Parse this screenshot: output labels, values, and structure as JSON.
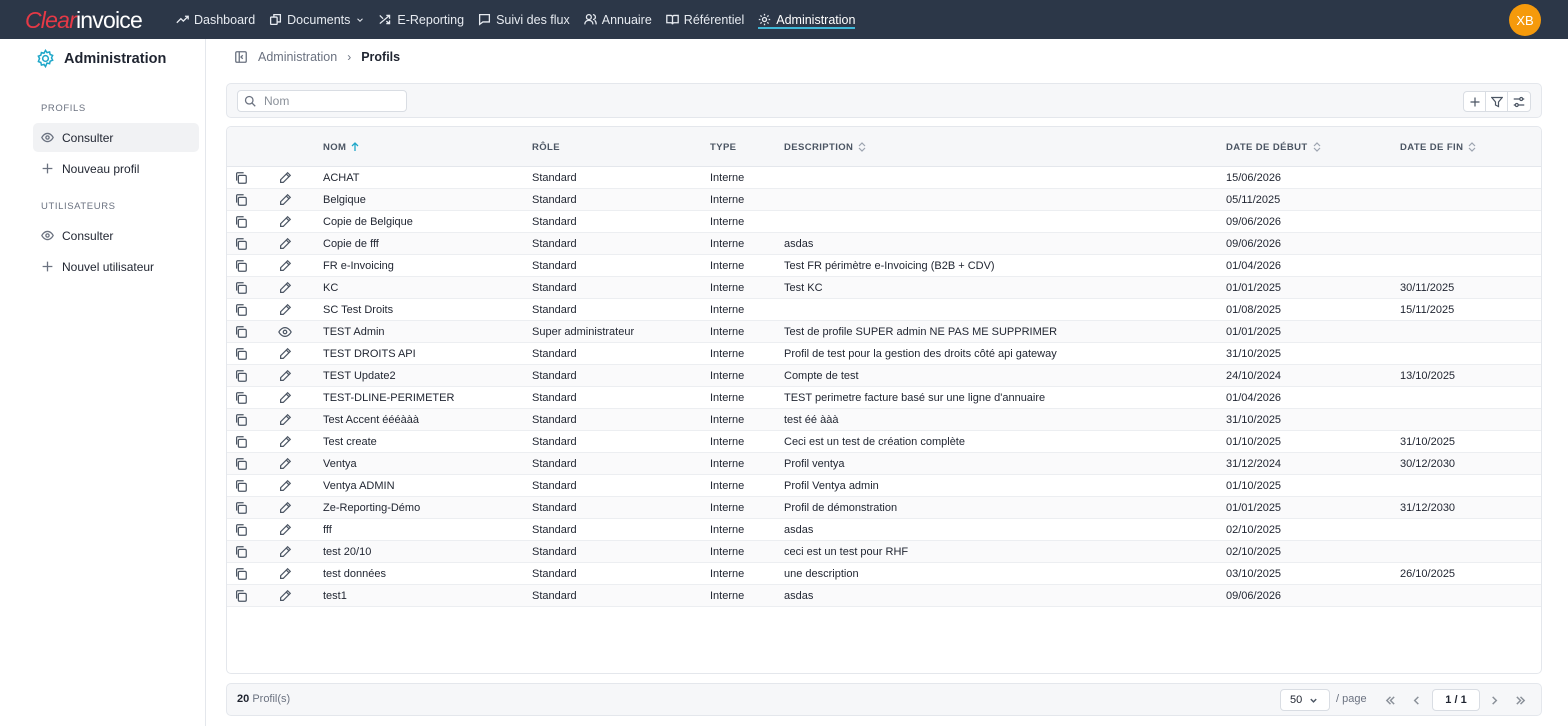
{
  "brand": {
    "part1": "Clear",
    "part2": "invoice"
  },
  "nav": [
    {
      "label": "Dashboard",
      "icon": "trending-up-icon"
    },
    {
      "label": "Documents",
      "icon": "documents-icon"
    },
    {
      "label": "E-Reporting",
      "icon": "shuffle-icon"
    },
    {
      "label": "Suivi des flux",
      "icon": "message-square-icon"
    },
    {
      "label": "Annuaire",
      "icon": "users-icon"
    },
    {
      "label": "Référentiel",
      "icon": "book-icon"
    },
    {
      "label": "Administration",
      "icon": "gear-icon",
      "active": true
    }
  ],
  "user": {
    "initials": "XB",
    "color": "#f59a0c"
  },
  "sidebar": {
    "title": "Administration",
    "sections": [
      {
        "label": "PROFILS",
        "items": [
          {
            "label": "Consulter",
            "icon": "eye-icon",
            "active": true
          },
          {
            "label": "Nouveau profil",
            "icon": "plus-icon"
          }
        ]
      },
      {
        "label": "UTILISATEURS",
        "items": [
          {
            "label": "Consulter",
            "icon": "eye-icon"
          },
          {
            "label": "Nouvel utilisateur",
            "icon": "plus-icon"
          }
        ]
      }
    ]
  },
  "breadcrumb": {
    "parent": "Administration",
    "separator": "›",
    "current": "Profils"
  },
  "search": {
    "placeholder": "Nom",
    "value": ""
  },
  "table": {
    "columns": {
      "nom": "NOM",
      "role": "RÔLE",
      "type": "TYPE",
      "description": "DESCRIPTION",
      "date_debut": "DATE DE DÉBUT",
      "date_fin": "DATE DE FIN"
    },
    "rows": [
      {
        "nom": "ACHAT",
        "role": "Standard",
        "type": "Interne",
        "description": "",
        "date_debut": "15/06/2026",
        "date_fin": "",
        "action": "edit"
      },
      {
        "nom": "Belgique",
        "role": "Standard",
        "type": "Interne",
        "description": "",
        "date_debut": "05/11/2025",
        "date_fin": "",
        "action": "edit"
      },
      {
        "nom": "Copie de Belgique",
        "role": "Standard",
        "type": "Interne",
        "description": "",
        "date_debut": "09/06/2026",
        "date_fin": "",
        "action": "edit"
      },
      {
        "nom": "Copie de fff",
        "role": "Standard",
        "type": "Interne",
        "description": "asdas",
        "date_debut": "09/06/2026",
        "date_fin": "",
        "action": "edit"
      },
      {
        "nom": "FR e-Invoicing",
        "role": "Standard",
        "type": "Interne",
        "description": "Test FR périmètre e-Invoicing (B2B + CDV)",
        "date_debut": "01/04/2026",
        "date_fin": "",
        "action": "edit"
      },
      {
        "nom": "KC",
        "role": "Standard",
        "type": "Interne",
        "description": "Test KC",
        "date_debut": "01/01/2025",
        "date_fin": "30/11/2025",
        "action": "edit"
      },
      {
        "nom": "SC Test Droits",
        "role": "Standard",
        "type": "Interne",
        "description": "",
        "date_debut": "01/08/2025",
        "date_fin": "15/11/2025",
        "action": "edit"
      },
      {
        "nom": "TEST Admin",
        "role": "Super administrateur",
        "type": "Interne",
        "description": "Test de profile SUPER admin NE PAS ME SUPPRIMER",
        "date_debut": "01/01/2025",
        "date_fin": "",
        "action": "view"
      },
      {
        "nom": "TEST DROITS API",
        "role": "Standard",
        "type": "Interne",
        "description": "Profil de test pour la gestion des droits côté api gateway",
        "date_debut": "31/10/2025",
        "date_fin": "",
        "action": "edit"
      },
      {
        "nom": "TEST Update2",
        "role": "Standard",
        "type": "Interne",
        "description": "Compte de test",
        "date_debut": "24/10/2024",
        "date_fin": "13/10/2025",
        "action": "edit"
      },
      {
        "nom": "TEST-DLINE-PERIMETER",
        "role": "Standard",
        "type": "Interne",
        "description": "TEST perimetre facture basé sur une ligne d'annuaire",
        "date_debut": "01/04/2026",
        "date_fin": "",
        "action": "edit"
      },
      {
        "nom": "Test Accent éééààà",
        "role": "Standard",
        "type": "Interne",
        "description": "test éé ààà",
        "date_debut": "31/10/2025",
        "date_fin": "",
        "action": "edit"
      },
      {
        "nom": "Test create",
        "role": "Standard",
        "type": "Interne",
        "description": "Ceci est un test de création complète",
        "date_debut": "01/10/2025",
        "date_fin": "31/10/2025",
        "action": "edit"
      },
      {
        "nom": "Ventya",
        "role": "Standard",
        "type": "Interne",
        "description": "Profil ventya",
        "date_debut": "31/12/2024",
        "date_fin": "30/12/2030",
        "action": "edit"
      },
      {
        "nom": "Ventya ADMIN",
        "role": "Standard",
        "type": "Interne",
        "description": "Profil Ventya admin",
        "date_debut": "01/10/2025",
        "date_fin": "",
        "action": "edit"
      },
      {
        "nom": "Ze-Reporting-Démo",
        "role": "Standard",
        "type": "Interne",
        "description": "Profil de démonstration",
        "date_debut": "01/01/2025",
        "date_fin": "31/12/2030",
        "action": "edit"
      },
      {
        "nom": "fff",
        "role": "Standard",
        "type": "Interne",
        "description": "asdas",
        "date_debut": "02/10/2025",
        "date_fin": "",
        "action": "edit"
      },
      {
        "nom": "test 20/10",
        "role": "Standard",
        "type": "Interne",
        "description": "ceci est un test pour RHF",
        "date_debut": "02/10/2025",
        "date_fin": "",
        "action": "edit"
      },
      {
        "nom": "test données",
        "role": "Standard",
        "type": "Interne",
        "description": "une description",
        "date_debut": "03/10/2025",
        "date_fin": "26/10/2025",
        "action": "edit"
      },
      {
        "nom": "test1",
        "role": "Standard",
        "type": "Interne",
        "description": "asdas",
        "date_debut": "09/06/2026",
        "date_fin": "",
        "action": "edit"
      }
    ]
  },
  "footer": {
    "count": "20",
    "count_label": "Profil(s)",
    "page_size": "50",
    "per_page_label": "/ page",
    "page": "1 / 1"
  },
  "colors": {
    "topbar": "#2c3748",
    "accent": "#1ea7c9",
    "brand_red": "#e63946"
  }
}
